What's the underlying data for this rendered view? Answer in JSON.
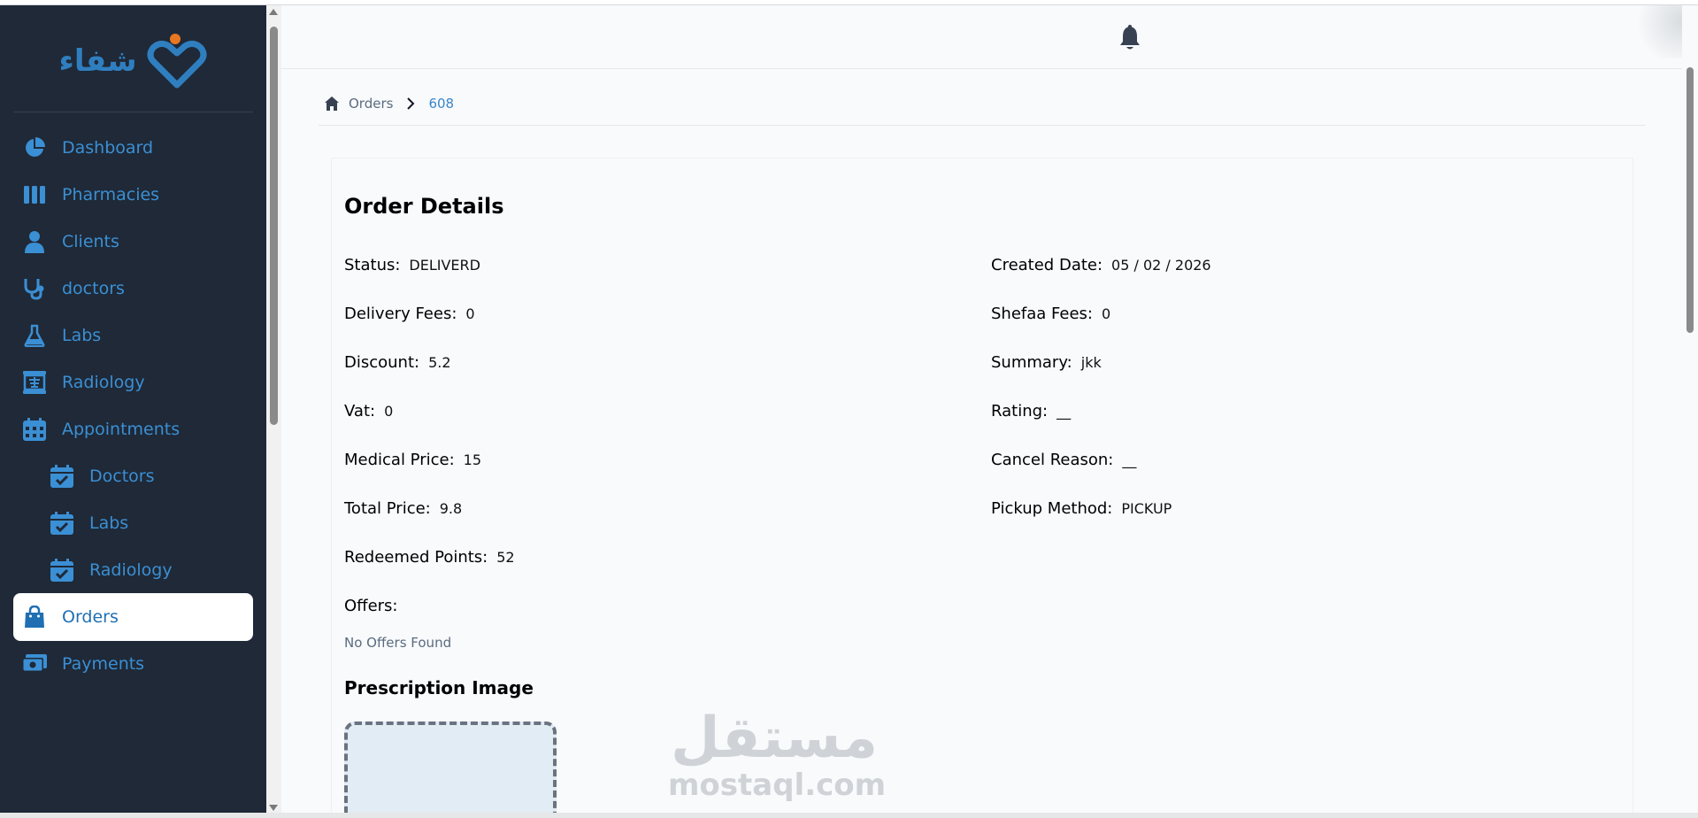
{
  "app": {
    "logo_text": "شفاء",
    "brand_color": "#2f7fc0",
    "accent_dot_color": "#e87722"
  },
  "sidebar": {
    "items": [
      {
        "label": "Dashboard",
        "icon": "pie-chart-icon"
      },
      {
        "label": "Pharmacies",
        "icon": "columns-icon"
      },
      {
        "label": "Clients",
        "icon": "user-icon"
      },
      {
        "label": "doctors",
        "icon": "stethoscope-icon"
      },
      {
        "label": "Labs",
        "icon": "flask-icon"
      },
      {
        "label": "Radiology",
        "icon": "xray-icon"
      },
      {
        "label": "Appointments",
        "icon": "calendar-icon"
      },
      {
        "label": "Doctors",
        "icon": "calendar-check-icon"
      },
      {
        "label": "Labs",
        "icon": "calendar-check-icon"
      },
      {
        "label": "Radiology",
        "icon": "calendar-check-icon"
      },
      {
        "label": "Orders",
        "icon": "shopping-bag-icon",
        "active": true
      },
      {
        "label": "Payments",
        "icon": "money-icon"
      }
    ]
  },
  "header": {
    "notification_icon": "bell-icon"
  },
  "breadcrumb": {
    "home_icon": "home-icon",
    "orders": "Orders",
    "current": "608"
  },
  "order": {
    "title": "Order Details",
    "left_fields": [
      {
        "label": "Status:",
        "value": "DELIVERD"
      },
      {
        "label": "Delivery Fees:",
        "value": "0"
      },
      {
        "label": "Discount:",
        "value": "5.2"
      },
      {
        "label": "Vat:",
        "value": "0"
      },
      {
        "label": "Medical Price:",
        "value": "15"
      },
      {
        "label": "Total Price:",
        "value": "9.8"
      },
      {
        "label": "Redeemed Points:",
        "value": "52"
      },
      {
        "label": "Offers:",
        "value": ""
      }
    ],
    "right_fields": [
      {
        "label": "Created Date:",
        "value": "05 / 02 / 2026"
      },
      {
        "label": "Shefaa Fees:",
        "value": "0"
      },
      {
        "label": "Summary:",
        "value": "jkk"
      },
      {
        "label": "Rating:",
        "value": "__"
      },
      {
        "label": "Cancel Reason:",
        "value": "__"
      },
      {
        "label": "Pickup Method:",
        "value": "PICKUP"
      }
    ],
    "no_offers": "No Offers Found",
    "prescription_title": "Prescription Image"
  },
  "watermark": {
    "arabic": "مستقل",
    "latin": "mostaql.com"
  }
}
